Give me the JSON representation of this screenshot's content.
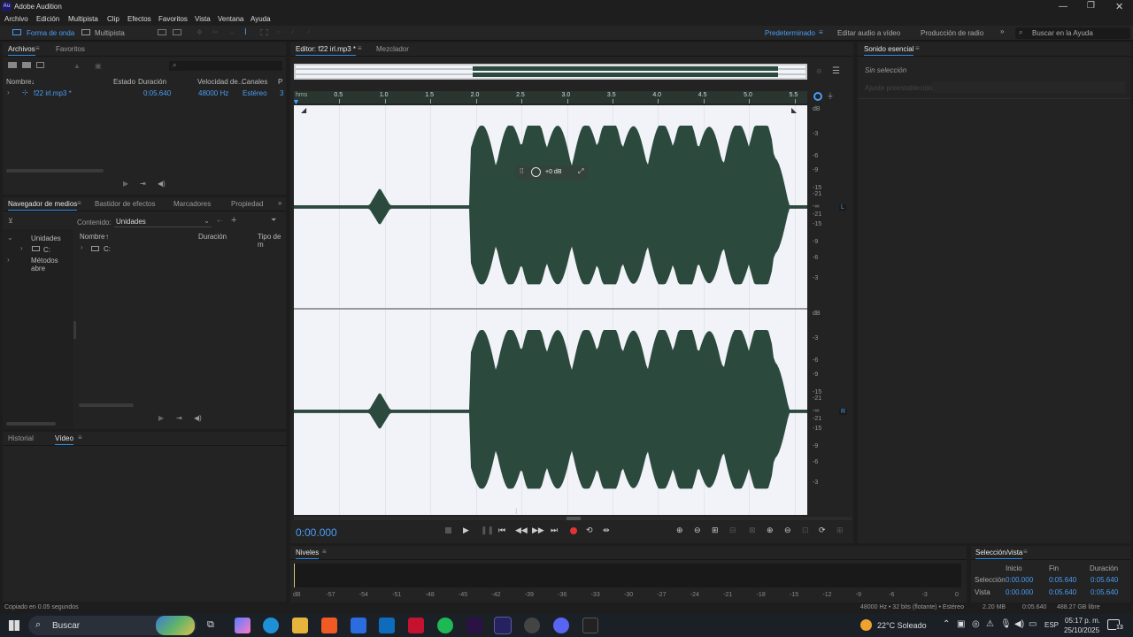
{
  "window": {
    "title": "Adobe Audition",
    "app_icon": "Au"
  },
  "menu": [
    "Archivo",
    "Edición",
    "Multipista",
    "Clip",
    "Efectos",
    "Favoritos",
    "Vista",
    "Ventana",
    "Ayuda"
  ],
  "toolbar": {
    "waveform_label": "Forma de onda",
    "multitrack_label": "Multipista",
    "workspaces": [
      "Predeterminado",
      "Editar audio a vídeo",
      "Producción de radio"
    ],
    "search_placeholder": "Buscar en la Ayuda"
  },
  "files_panel": {
    "tabs": [
      "Archivos",
      "Favoritos"
    ],
    "columns": [
      "Nombre",
      "Estado",
      "Duración",
      "Velocidad de...",
      "Canales",
      "P"
    ],
    "rows": [
      {
        "name": "f22 irl.mp3 *",
        "state": "",
        "duration": "0:05.640",
        "rate": "48000 Hz",
        "channels": "Estéreo",
        "extra": "3"
      }
    ]
  },
  "media_panel": {
    "tabs": [
      "Navegador de medios",
      "Bastidor de efectos",
      "Marcadores",
      "Propiedad"
    ],
    "content_label": "Contenido:",
    "content_value": "Unidades",
    "tree": [
      "Unidades",
      "C:",
      "Métodos abre"
    ],
    "columns": [
      "Nombre",
      "Duración",
      "Tipo de m"
    ],
    "rows": [
      {
        "name": "C:"
      }
    ]
  },
  "bottom_left": {
    "tabs": [
      "Historial",
      "Vídeo"
    ]
  },
  "editor": {
    "tabs": [
      "Editor: f22 irl.mp3 *",
      "Mezclador"
    ],
    "ruler_unit": "hms",
    "ruler_ticks": [
      "0.5",
      "1.0",
      "1.5",
      "2.0",
      "2.5",
      "3.0",
      "3.5",
      "4.0",
      "4.5",
      "5.0",
      "5.5"
    ],
    "db_label": "dB",
    "db_ticks_top": [
      "-3",
      "-6",
      "-9",
      "-15",
      "-21",
      "-∞",
      "-21",
      "-15",
      "-9",
      "-6",
      "-3"
    ],
    "db_ticks_bottom": [
      "-3",
      "-6",
      "-9",
      "-15",
      "-21",
      "-∞",
      "-21",
      "-15",
      "-9",
      "-6",
      "-3"
    ],
    "channel_left": "L",
    "channel_right": "R",
    "hud_gain": "+0 dB",
    "time_display": "0:00.000"
  },
  "essential_sound": {
    "title": "Sonido esencial",
    "no_selection": "Sin selección",
    "preset_label": "Ajuste preestablecido:"
  },
  "levels": {
    "title": "Niveles",
    "scale": [
      "dB",
      "-57",
      "-54",
      "-51",
      "-48",
      "-45",
      "-42",
      "-39",
      "-36",
      "-33",
      "-30",
      "-27",
      "-24",
      "-21",
      "-18",
      "-15",
      "-12",
      "-9",
      "-6",
      "-3",
      "0"
    ]
  },
  "selection_view": {
    "title": "Selección/vista",
    "headers": [
      "Inicio",
      "Fin",
      "Duración"
    ],
    "rows": [
      {
        "label": "Selección",
        "start": "0:00.000",
        "end": "0:05.640",
        "duration": "0:05.640"
      },
      {
        "label": "Vista",
        "start": "0:00.000",
        "end": "0:05.640",
        "duration": "0:05.640"
      }
    ]
  },
  "status": {
    "left": "Copiado en 0.05 segundos",
    "format": "48000 Hz • 32 bits (flotante) • Estéreo",
    "size": "2.20 MB",
    "duration": "0:05.640",
    "free": "488.27 GB libre"
  },
  "taskbar": {
    "search": "Buscar",
    "weather": "22°C  Soleado",
    "lang": "ESP",
    "time": "05:17 p. m.",
    "date": "25/10/2025",
    "notif": "13"
  },
  "colors": {
    "accent": "#2d8ceb",
    "waveform": "#2b4a3d",
    "wave_bg": "#f2f3f9"
  }
}
